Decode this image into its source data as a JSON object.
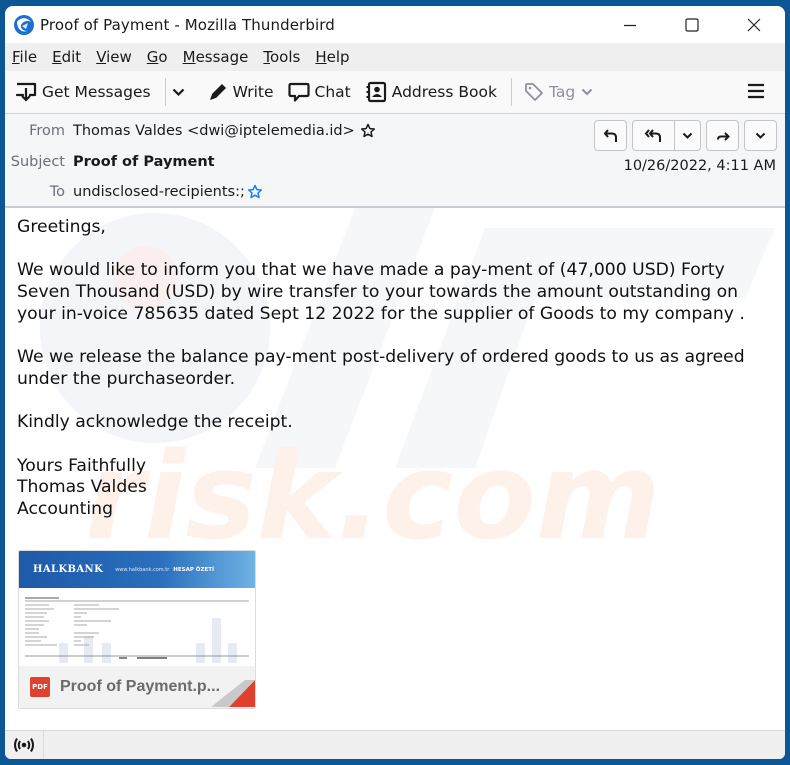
{
  "window": {
    "title": "Proof of Payment - Mozilla Thunderbird",
    "app_icon": "thunderbird-logo-icon",
    "controls": [
      "minimize-icon",
      "maximize-icon",
      "close-icon"
    ]
  },
  "menubar": {
    "items": [
      {
        "mnemonic": "F",
        "rest": "ile"
      },
      {
        "mnemonic": "E",
        "rest": "dit"
      },
      {
        "mnemonic": "V",
        "rest": "iew"
      },
      {
        "mnemonic": "G",
        "rest": "o"
      },
      {
        "mnemonic": "M",
        "rest": "essage"
      },
      {
        "mnemonic": "T",
        "rest": "ools"
      },
      {
        "mnemonic": "H",
        "rest": "elp"
      }
    ]
  },
  "toolbar": {
    "get_messages": "Get Messages",
    "write": "Write",
    "chat": "Chat",
    "address_book": "Address Book",
    "tag": "Tag"
  },
  "header": {
    "from_label": "From",
    "from_value": "Thomas Valdes <dwi@iptelemedia.id>",
    "subject_label": "Subject",
    "subject_value": "Proof of Payment",
    "to_label": "To",
    "to_value": "undisclosed-recipients:;",
    "date": "10/26/2022, 4:11 AM",
    "actions": [
      "reply",
      "reply-all",
      "reply-all-dropdown",
      "forward",
      "more"
    ]
  },
  "body": {
    "greeting": "Greetings,",
    "paragraph1": "We would like to inform you that we have made a pay-ment of (47,000 USD) Forty Seven Thousand (USD) by wire transfer to your towards the amount outstanding on your in-voice 785635 dated Sept 12 2022 for the supplier of Goods to my company .",
    "paragraph2": "We we release the balance pay-ment post-delivery of ordered goods to us as agreed under the purchaseorder.",
    "paragraph3": "Kindly acknowledge the receipt.",
    "sign_off": [
      "Yours Faithfully",
      "Thomas Valdes",
      "Accounting"
    ]
  },
  "attachment": {
    "type_badge": "PDF",
    "name": "Proof of Payment.p...",
    "thumb_bank": "HALKBANK",
    "thumb_url": "www.halkbank.com.tr",
    "thumb_title": "HESAP ÖZETİ"
  },
  "colors": {
    "window_border": "#0d5696",
    "pdf_red": "#e0412f",
    "bank_blue": "#1d5aa8",
    "star_blue": "#0a84ff"
  }
}
